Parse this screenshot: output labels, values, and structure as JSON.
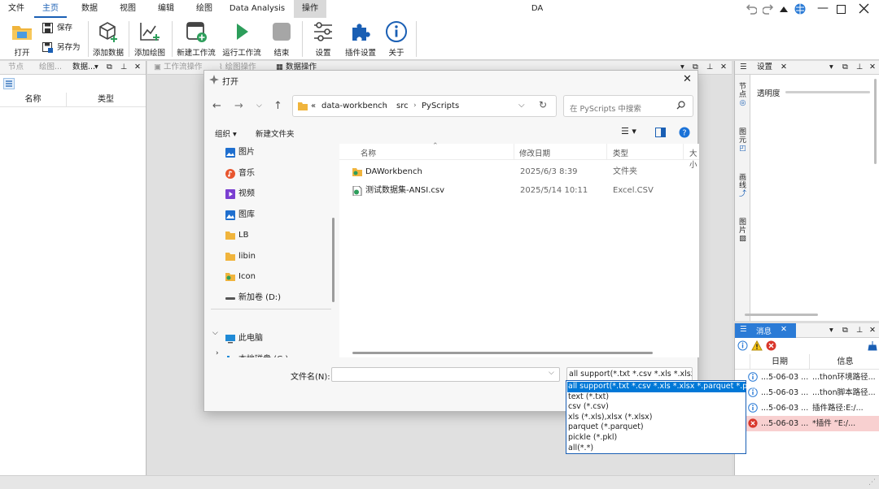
{
  "window": {
    "title": "DA"
  },
  "ribbon_tabs": [
    "文件",
    "主页",
    "数据",
    "视图",
    "编辑",
    "绘图",
    "Data Analysis",
    "操作"
  ],
  "ribbon": {
    "open": "打开",
    "save": "保存",
    "save_as": "另存为",
    "add_data": "添加数据",
    "add_plot": "添加绘图",
    "new_workflow": "新建工作流",
    "run_workflow": "运行工作流",
    "end": "结束",
    "settings": "设置",
    "plugin_settings": "插件设置",
    "about": "关于"
  },
  "left_panel": {
    "tabs": [
      "节点",
      "绘图...",
      "数据..."
    ],
    "columns": [
      "名称",
      "类型"
    ]
  },
  "center_panel": {
    "tabs": [
      "工作流操作",
      "绘图操作",
      "数据操作"
    ]
  },
  "right_panel": {
    "tab": "设置",
    "side_tabs": [
      "节点",
      "图元",
      "画线",
      "图片"
    ],
    "opacity_label": "透明度"
  },
  "message_panel": {
    "tab": "消息",
    "columns": [
      "日期",
      "信息"
    ],
    "rows": [
      {
        "type": "info",
        "date": "...5-06-03 ...",
        "info": "...thon环境路径..."
      },
      {
        "type": "info",
        "date": "...5-06-03 ...",
        "info": "...thon脚本路径..."
      },
      {
        "type": "info",
        "date": "...5-06-03 ...",
        "info": "插件路径:E:/..."
      },
      {
        "type": "error",
        "date": "...5-06-03 ...",
        "info": "*插件 “E:/..."
      }
    ]
  },
  "dialog": {
    "title": "打开",
    "breadcrumb": [
      "«",
      "data-workbench",
      "src",
      "PyScripts"
    ],
    "search_placeholder": "在 PyScripts 中搜索",
    "organize": "组织 ▾",
    "new_folder": "新建文件夹",
    "nav": [
      {
        "label": "图片",
        "icon": "pictures-icon",
        "pinned": true
      },
      {
        "label": "音乐",
        "icon": "music-icon",
        "pinned": true
      },
      {
        "label": "视频",
        "icon": "videos-icon",
        "pinned": true
      },
      {
        "label": "图库",
        "icon": "gallery-icon",
        "pinned": true
      },
      {
        "label": "LB",
        "icon": "folder-icon",
        "pinned": false
      },
      {
        "label": "libin",
        "icon": "folder-icon",
        "pinned": false
      },
      {
        "label": "Icon",
        "icon": "folder-icon",
        "pinned": false
      },
      {
        "label": "新加卷 (D:)",
        "icon": "drive-icon",
        "pinned": false
      },
      {
        "label": "此电脑",
        "icon": "pc-icon",
        "pinned": false
      },
      {
        "label": "本地磁盘 (C:)",
        "icon": "drive-icon",
        "pinned": false
      }
    ],
    "columns": [
      "名称",
      "修改日期",
      "类型",
      "大小"
    ],
    "files": [
      {
        "name": "DAWorkbench",
        "date": "2025/6/3 8:39",
        "type": "文件夹"
      },
      {
        "name": "测试数据集-ANSI.csv",
        "date": "2025/5/14 10:11",
        "type": "Excel.CSV"
      }
    ],
    "filename_label": "文件名(N):",
    "filename_value": "",
    "filter_selected": "all support(*.txt *.csv *.xls *.xlsx *.parquet *.pkl)",
    "filter_options": [
      "all support(*.txt *.csv *.xls *.xlsx *.parquet *.pkl)",
      "text (*.txt)",
      "csv (*.csv)",
      "xls (*.xls),xlsx (*.xlsx)",
      "parquet (*.parquet)",
      "pickle (*.pkl)",
      "all(*.*)"
    ]
  },
  "colors": {
    "accent": "#1a5fb4",
    "selection": "#0078d7",
    "error_row": "#f8d0d0",
    "tab_active_bg": "#d9d9d9"
  }
}
